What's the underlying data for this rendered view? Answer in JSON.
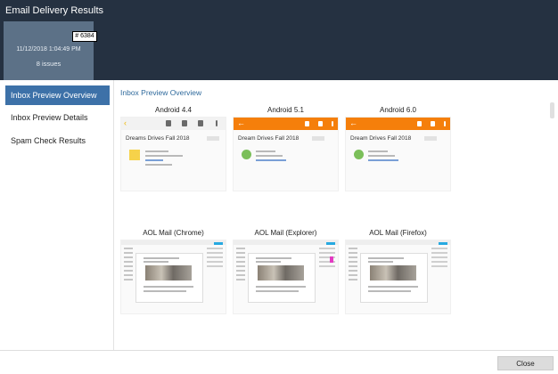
{
  "window": {
    "title": "Email Delivery Results"
  },
  "run": {
    "id": "# 6384",
    "date": "11/12/2018 1:04:49 PM",
    "issues": "8 issues"
  },
  "sidebar": {
    "items": [
      {
        "label": "Inbox Preview Overview",
        "active": true
      },
      {
        "label": "Inbox Preview Details",
        "active": false
      },
      {
        "label": "Spam Check Results",
        "active": false
      }
    ]
  },
  "main": {
    "section_title": "Inbox Preview Overview",
    "previews": [
      {
        "label": "Android 4.4",
        "subject": "Dreams Drives Fall 2018"
      },
      {
        "label": "Android 5.1",
        "subject": "Dream Drives Fall 2018"
      },
      {
        "label": "Android 6.0",
        "subject": "Dream Drives Fall 2018"
      },
      {
        "label": "AOL Mail (Chrome)"
      },
      {
        "label": "AOL Mail (Explorer)"
      },
      {
        "label": "AOL Mail (Firefox)"
      }
    ]
  },
  "footer": {
    "close_label": "Close"
  },
  "colors": {
    "header": "#253141",
    "run_card": "#5c7187",
    "accent": "#3d71a8",
    "android_bar": "#f57f0b"
  }
}
